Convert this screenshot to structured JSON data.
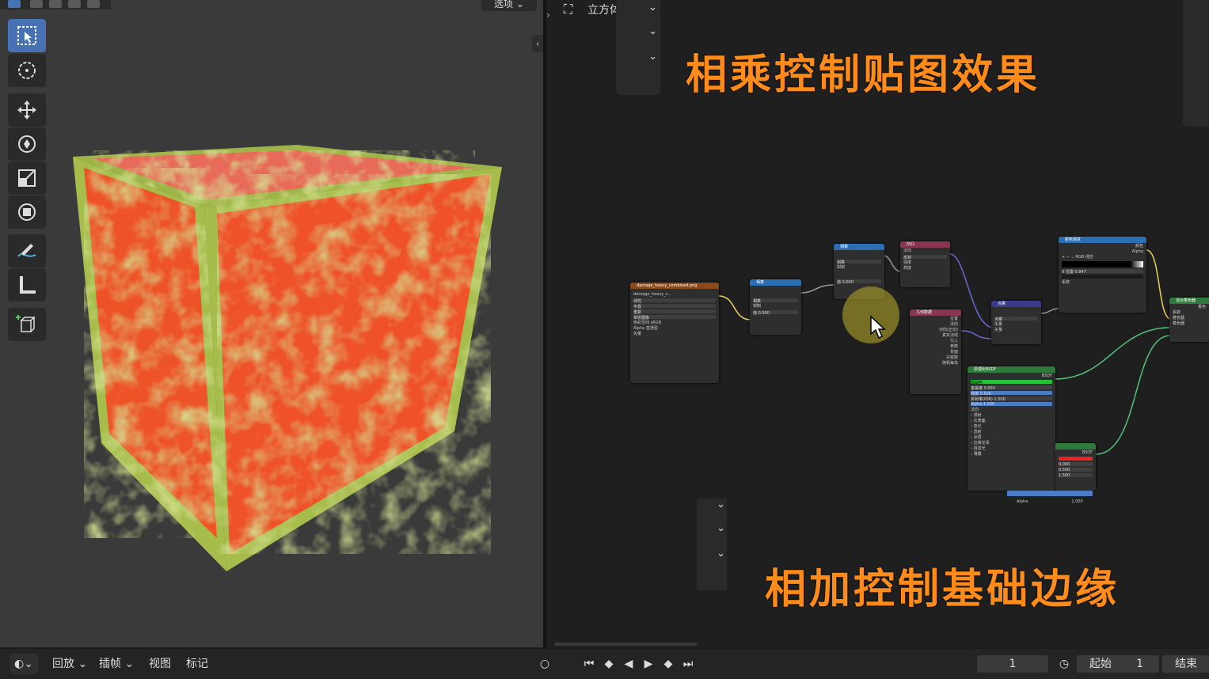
{
  "viewport": {
    "options_label": "选项"
  },
  "node_editor": {
    "object_label": "立方体",
    "title_top": "相乘控制贴图效果",
    "title_bottom": "相加控制基础边缘",
    "nodes": {
      "image_texture": {
        "title": "damage_heavy_combined.png",
        "file": "damage_heavy_c...",
        "rows": [
          "线性",
          "平直",
          "重复",
          "单张图像"
        ],
        "color_space_label": "色彩空间",
        "color_space": "sRGB",
        "alpha_label": "Alpha",
        "alpha_mode": "直通型",
        "vector_label": "矢量"
      },
      "multiply1": {
        "title": "相乘",
        "op": "相乘",
        "clamp": "钳制",
        "value_label": "值",
        "value": "0.500"
      },
      "multiply2": {
        "title": "相乘",
        "op": "相乘",
        "clamp": "钳制",
        "value_label": "值",
        "value": "0.000"
      },
      "bump": {
        "title": "凹凸",
        "rows": [
          "反转",
          "强度",
          "距离",
          "高度",
          "法向"
        ]
      },
      "geometry": {
        "title": "几何数据",
        "rows": [
          "位置",
          "法向",
          "切向(正切)",
          "真实法线",
          "引入",
          "参数",
          "背面",
          "尖锐度",
          "随机每岛"
        ]
      },
      "add": {
        "title": "点乘",
        "op": "点乘",
        "vec1": "矢量",
        "vec2": "矢量"
      },
      "color_ramp": {
        "title": "颜色渐变",
        "mode": "RGB",
        "interp": "线性",
        "pos_label": "位置",
        "pos_value": "0.847",
        "index": "0",
        "out_color": "颜色",
        "out_alpha": "Alpha",
        "factor": "系数"
      },
      "bsdf": {
        "title": "原理化BSDF",
        "base": "基础色",
        "metallic": "金属度",
        "metallic_v": "0.000",
        "roughness": "糙度",
        "roughness_v": "0.500",
        "ior": "折射率(IOR)",
        "ior_v": "1.500",
        "alpha": "Alpha",
        "alpha_v": "1.000",
        "normal": "法向",
        "sections": [
          "漫射",
          "次表面",
          "高光",
          "透射",
          "涂层",
          "边缘光泽",
          "自发光",
          "薄膜"
        ],
        "out": "BSDF"
      },
      "bsdf2": {
        "out": "BSDF",
        "v1": "0.000",
        "v2": "0.500",
        "v3": "1.500",
        "alpha": "Alpha",
        "alpha_v": "1.000"
      },
      "mix_shader": {
        "title": "混合着色器",
        "rows": [
          "系数",
          "着色器",
          "着色器"
        ],
        "out": "着色"
      }
    }
  },
  "timeline": {
    "playback": "回放",
    "keying": "插帧",
    "view": "视图",
    "marker": "标记",
    "current_frame": "1",
    "start_label": "起始",
    "start_value": "1",
    "end_label": "结束"
  },
  "colors": {
    "title_orange": "#ff8c1a",
    "cube_orange": "#f0502a",
    "cube_green": "#a8c04a",
    "active_tool": "#4772b3"
  }
}
